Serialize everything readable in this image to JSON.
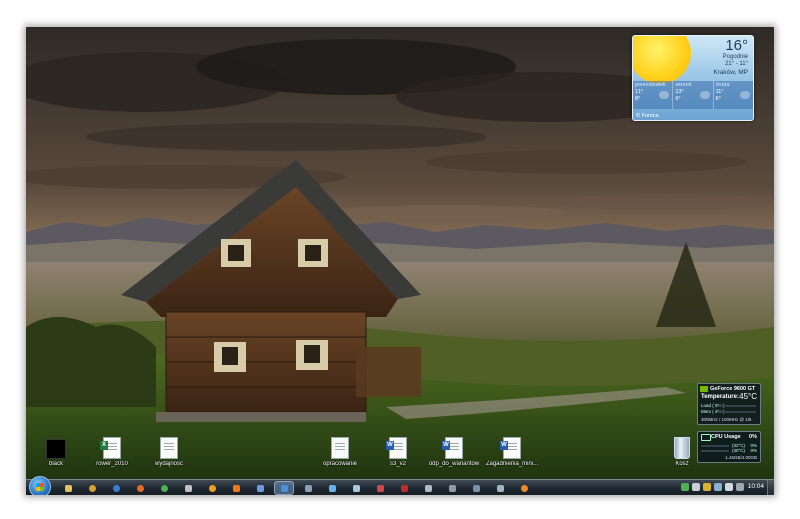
{
  "weather": {
    "temperature": "16°",
    "condition": "Pogodnie",
    "range": "21° - 11°",
    "location": "Kraków, MP",
    "days": [
      {
        "name": "poniedziałek",
        "high": "11°",
        "low": "8°"
      },
      {
        "name": "wtorek",
        "high": "13°",
        "low": "6°"
      },
      {
        "name": "środa",
        "high": "11°",
        "low": "6°"
      }
    ],
    "provider": "© Foreca"
  },
  "gpu_gadget": {
    "title": "GeForce 9600 GT",
    "temp_label": "Temperature:",
    "temp_value": "45°C",
    "load_label": "Load ( 0% )",
    "mem_label": "Mem ( 4% )",
    "clocks": "300MHz / 100MHz @ 1l6"
  },
  "cpu_gadget": {
    "title": "CPU Usage",
    "total": "0%",
    "cores": [
      {
        "temp": "(32°C)",
        "usage": "0%"
      },
      {
        "temp": "(30°C)",
        "usage": "0%"
      }
    ],
    "memory": "1.46GB/4.00GB"
  },
  "desktop_icons": [
    {
      "label": "black"
    },
    {
      "label": "rower_2010"
    },
    {
      "label": "wydajnosc"
    },
    {
      "label": "opracowanie"
    },
    {
      "label": "s3_v2"
    },
    {
      "label": "odp_do_wariantow"
    },
    {
      "label": "Zagadnienia_mini..."
    },
    {
      "label": "Kosz"
    }
  ],
  "taskbar": {
    "clock": "10:04"
  },
  "colors": {
    "taskbar": "#1e2730",
    "accent": "#2a78c8"
  }
}
